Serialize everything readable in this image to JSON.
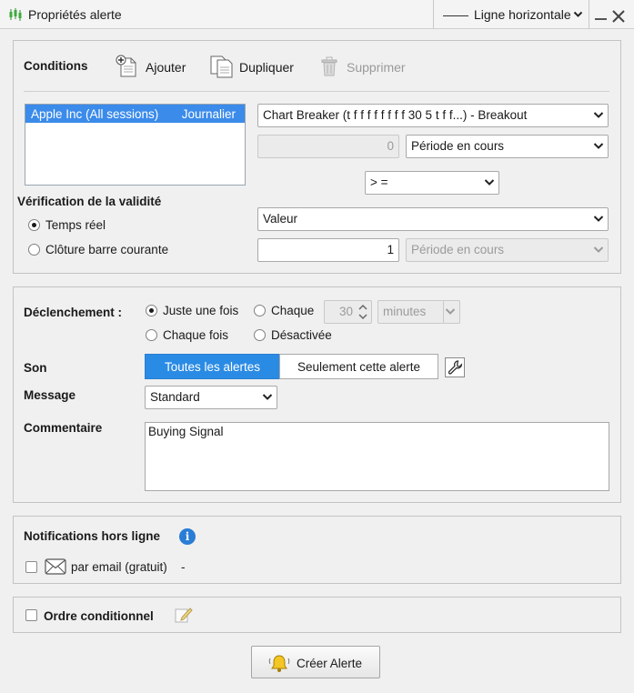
{
  "window": {
    "title": "Propriétés alerte",
    "drawing_tool": "Ligne horizontale",
    "minimize_icon": "minimize-icon",
    "close_glyph": "✕"
  },
  "conditions": {
    "heading": "Conditions",
    "add_label": "Ajouter",
    "duplicate_label": "Dupliquer",
    "delete_label": "Supprimer",
    "symbols": [
      {
        "name": "Apple Inc (All sessions)",
        "period": "Journalier",
        "selected": true
      }
    ],
    "indicator_select": "Chart Breaker (t f f f f f f f f 30 5 t f f...)  - Breakout",
    "offset_value": "0",
    "period_select_1": "Période en cours",
    "operator_select": "> =",
    "target_select": "Valeur",
    "target_value": "1",
    "period_select_2": "Période en cours"
  },
  "validity": {
    "heading": "Vérification de la validité",
    "options": [
      {
        "label": "Temps réel",
        "selected": true
      },
      {
        "label": "Clôture barre courante",
        "selected": false
      }
    ]
  },
  "trigger": {
    "heading": "Déclenchement :",
    "once_label": "Juste une fois",
    "every_label": "Chaque",
    "every_value": "30",
    "every_unit": "minutes",
    "each_time_label": "Chaque fois",
    "disabled_label": "Désactivée",
    "selected": "once"
  },
  "sound": {
    "heading": "Son",
    "all_alerts": "Toutes les alertes",
    "this_alert": "Seulement cette alerte",
    "active": "all_alerts"
  },
  "message": {
    "heading": "Message",
    "value": "Standard"
  },
  "comment": {
    "heading": "Commentaire",
    "value": "Buying Signal"
  },
  "notifications": {
    "heading": "Notifications hors ligne",
    "email_label": "par email (gratuit)",
    "email_suffix": "-",
    "email_checked": false
  },
  "order": {
    "heading": "Ordre conditionnel",
    "checked": false
  },
  "create_button": "Créer Alerte",
  "colors": {
    "accent": "#2a8be5",
    "selection": "#3b8bea",
    "panel": "#f0f0f0"
  }
}
